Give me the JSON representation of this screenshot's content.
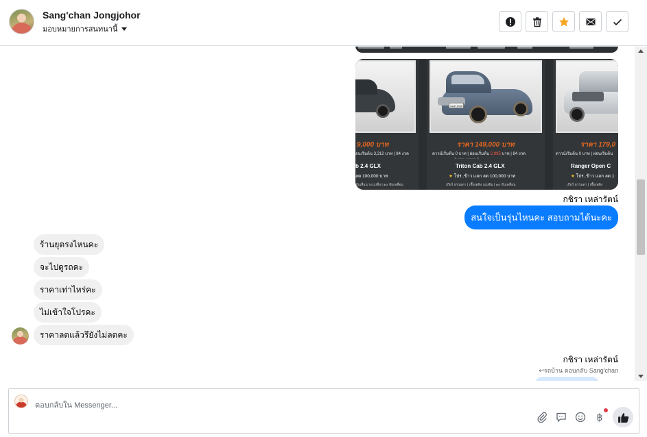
{
  "header": {
    "contact_name": "Sang'chan Jongjohor",
    "assign_label": "มอบหมายการสนทนานี้",
    "actions": [
      {
        "name": "spam-button",
        "icon": "alert-icon"
      },
      {
        "name": "delete-button",
        "icon": "trash-icon"
      },
      {
        "name": "star-button",
        "icon": "star-icon",
        "color": "#f5a623"
      },
      {
        "name": "mark-unread-button",
        "icon": "envelope-icon"
      },
      {
        "name": "mark-done-button",
        "icon": "check-icon"
      }
    ]
  },
  "car_listing": {
    "top_strip_text": [
      "",
      "",
      "",
      ""
    ],
    "panels": [
      {
        "price": "9,000 บาท",
        "installment": "อนเริ่มต้น 3,312 บาท | 84 งวด",
        "model": "b 2.4 GLX",
        "promo": "ลด 100,000 บาท",
        "feet": "ขับเลื่อน ระบบสื่อ  |  ๑๐ ขับเคลื่อน"
      },
      {
        "price": "ราคา 149,000 บาท",
        "installment_a": "ดาวน์เริ่มต้น 0 บาท | ผ่อนเริ่มต้น",
        "installment_red": "2,995",
        "installment_b": "บาท | 84 งวด",
        "model": "Triton Cab 2.4 GLX",
        "promo": "โปร..ข้าว แลก ลด 100,000 บาท",
        "feet": "เกียร์ ธรรมดา  |  เชื้อเพลิง เบนซิน  |  ๑๐ ขับเคลื่อน",
        "plate": "1ฒล 1548"
      },
      {
        "price": "ราคา 179,0",
        "installment": "ดาวน์เริ่มต้น 0 บาท | ผ่อนเริ่มต้น",
        "model": "Ranger Open C",
        "promo": "โปร..ข้าว แลก ลด 1",
        "feet": "เกียร์ ธรรมดา  |  เชื้อเพลิง"
      }
    ]
  },
  "messages": {
    "agent_name_1": "กชิรา เหล่ารัตน์",
    "outgoing_1": "สนใจเป็นรุ่นไหนคะ สอบถามได้นะคะ",
    "incoming": [
      "ร้านยุตรงไหนคะ",
      "จะไปดูรถคะ",
      "ราคาเท่าไหร่คะ",
      "ไม่เข้าใจโปรคะ",
      "ราคาลดแล้วรึยังไม่ลดคะ"
    ],
    "agent_name_2": "กชิรา เหล่ารัตน์",
    "reply_note": "รถบ้าน ตอบกลับ Sang'chan"
  },
  "composer": {
    "placeholder": "ตอบกลับใน Messenger..."
  },
  "colors": {
    "accent": "#0a7cff",
    "incoming_bubble": "#f0f0f0",
    "star": "#f5a623"
  }
}
